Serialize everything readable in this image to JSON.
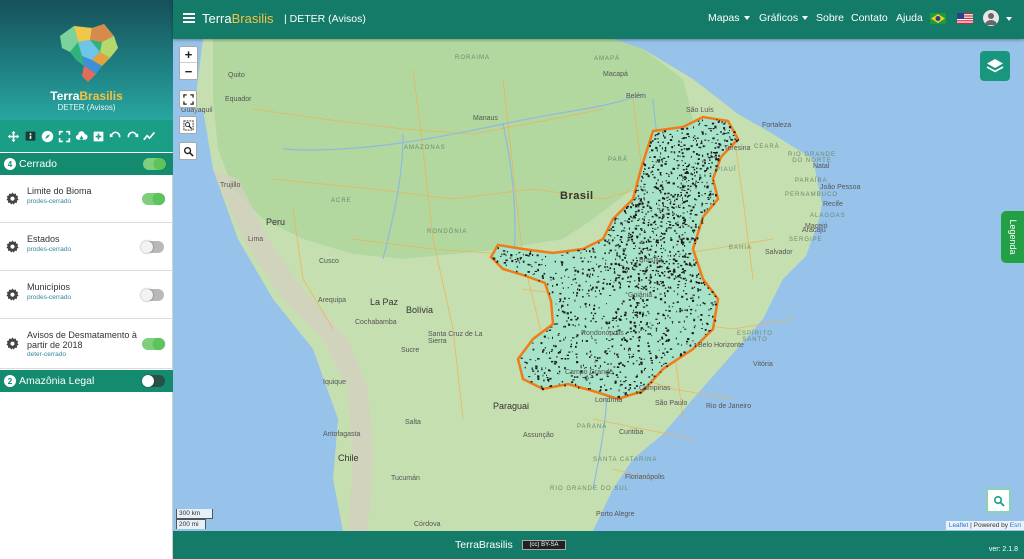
{
  "sidebar": {
    "brand_part1": "Terra",
    "brand_part2": "Brasilis",
    "subtitle": "DETER (Avisos)",
    "groups": [
      {
        "badge": "4",
        "label": "Cerrado",
        "enabled": true,
        "layers": [
          {
            "name": "Limite do Bioma",
            "source": "prodes-cerrado",
            "enabled": true
          },
          {
            "name": "Estados",
            "source": "prodes-cerrado",
            "enabled": false
          },
          {
            "name": "Municípios",
            "source": "prodes-cerrado",
            "enabled": false
          },
          {
            "name": "Avisos de Desmatamento à partir de 2018",
            "source": "deter-cerrado",
            "enabled": true
          }
        ]
      },
      {
        "badge": "2",
        "label": "Amazônia Legal",
        "enabled": false
      }
    ],
    "tools": [
      "pan-icon",
      "info-icon",
      "compass-icon",
      "fullscreen-icon",
      "cloud-download-icon",
      "add-icon",
      "undo-icon",
      "redo-icon",
      "chart-line-icon"
    ]
  },
  "navbar": {
    "title_part1": "Terra",
    "title_part2": "Brasilis",
    "subtitle": "| DETER (Avisos)",
    "menu": {
      "mapas": "Mapas",
      "graficos": "Gráficos",
      "sobre": "Sobre",
      "contato": "Contato",
      "ajuda": "Ajuda"
    },
    "languages": [
      "pt-BR",
      "en-US"
    ]
  },
  "map": {
    "zoom_in": "+",
    "zoom_out": "−",
    "legend_tab": "Legenda",
    "scale_km": "300 km",
    "scale_mi": "200 mi",
    "attribution_leaflet": "Leaflet",
    "attribution_sep": " | Powered by ",
    "attribution_esri": "Esri",
    "labels": {
      "brasil": "Brasil",
      "peru": "Peru",
      "bolivia": "Bolívia",
      "paraguai": "Paraguai",
      "chile": "Chile",
      "equador": "Equador",
      "roraima": "RORAIMA",
      "amapa": "AMAPÁ",
      "amazonas": "AMAZONAS",
      "acre": "ACRE",
      "rondonia": "RONDÔNIA",
      "para": "PARÁ",
      "piaui": "PIAUÍ",
      "ceara": "CEARÁ",
      "rgn": "RIO GRANDE DO NORTE",
      "paraiba": "PARAÍBA",
      "pernambuco": "PERNAMBUCO",
      "alagoas": "ALAGOAS",
      "sergipe": "SERGIPE",
      "bahia": "BAHIA",
      "es": "ESPÍRITO SANTO",
      "parana": "PARANÁ",
      "sc": "SANTA CATARINA",
      "rgs": "RIO GRANDE DO SUL",
      "quito": "Quito",
      "guayaquil": "Guayaquil",
      "trujillo": "Trujillo",
      "lima": "Lima",
      "cusco": "Cusco",
      "arequipa": "Arequipa",
      "lapaz": "La Paz",
      "cochabamba": "Cochabamba",
      "santacruz": "Santa Cruz de La Sierra",
      "sucre": "Sucre",
      "manaus": "Manaus",
      "belem": "Belém",
      "macapa": "Macapá",
      "saoluis": "São Luís",
      "fortaleza": "Fortaleza",
      "teresina": "Teresina",
      "natal": "Natal",
      "joaopessoa": "João Pessoa",
      "recife": "Recife",
      "maceio": "Maceió",
      "aracaju": "Aracaju",
      "salvador": "Salvador",
      "brasilia": "Brasília",
      "goiania": "Goiânia",
      "bh": "Belo Horizonte",
      "vitoria": "Vitória",
      "riodejaneiro": "Rio de Janeiro",
      "saopaulo": "São Paulo",
      "campinas": "Campinas",
      "londrina": "Londrina",
      "curitiba": "Curitiba",
      "florianopolis": "Florianópolis",
      "portoalegre": "Porto Alegre",
      "assuncao": "Assunção",
      "salta": "Salta",
      "iquique": "Iquique",
      "antofagasta": "Antofagasta",
      "cordova": "Córdova",
      "tucuman": "Tucumán",
      "rondonopolis": "Rondonópolis",
      "campogrande": "Campo Grande"
    }
  },
  "footer": {
    "brand": "TerraBrasilis",
    "license": "(cc) BY-SA",
    "version": "ver: 2.1.8"
  },
  "colors": {
    "header": "#137b67",
    "toolbar": "#1b9e86",
    "group": "#148a6e",
    "accent_yellow": "#f5c242",
    "toggle_on": "#5bc45a",
    "legend_tab": "#23a046",
    "cerrado_fill": "#a6e3c9",
    "cerrado_border": "#f07c16",
    "alerts": "#1a1a1a"
  }
}
